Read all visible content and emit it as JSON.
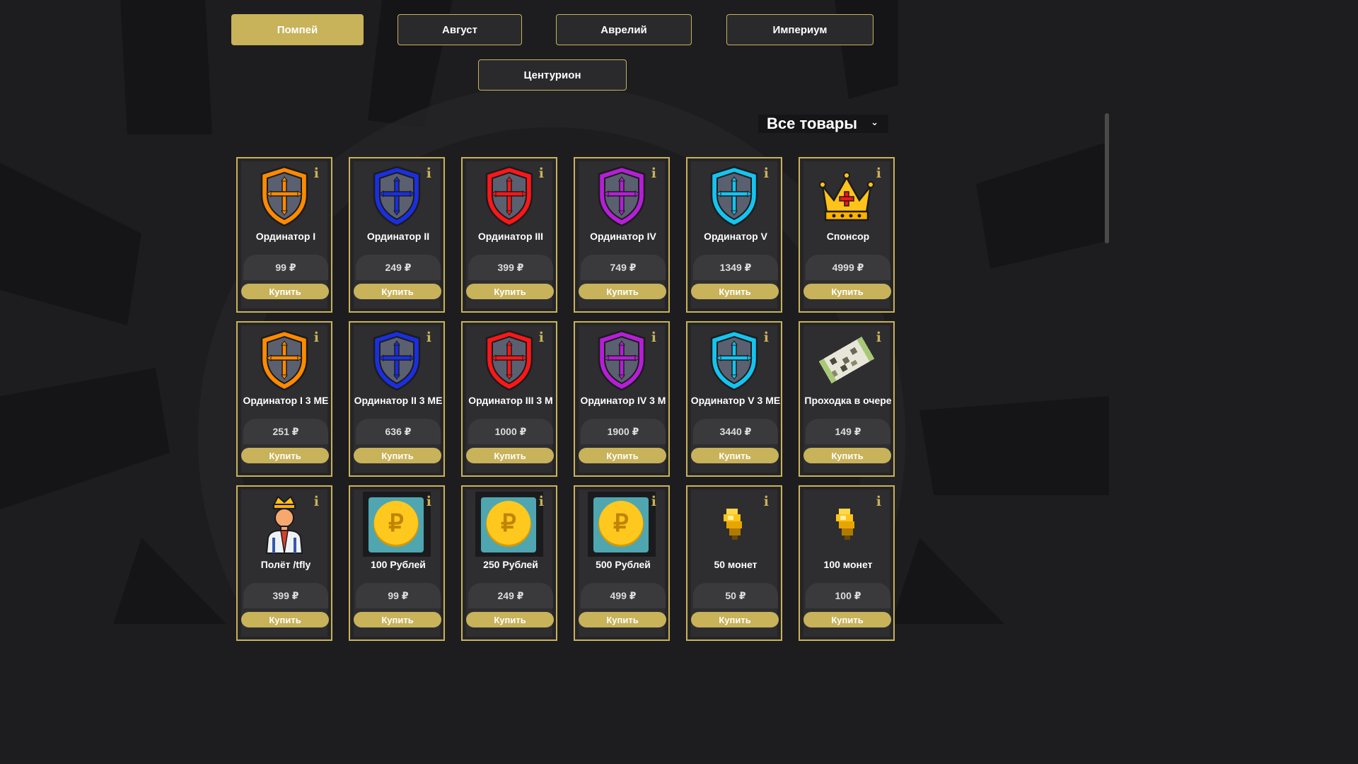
{
  "servers": {
    "pompey": "Помпей",
    "august": "Август",
    "aurelius": "Аврелий",
    "imperium": "Империум",
    "centurion": "Центурион"
  },
  "filter": {
    "label": "Все товары"
  },
  "buy_label": "Купить",
  "info_glyph": "i",
  "colors": {
    "gold": "#c8b25a",
    "orange": "#ff8a00",
    "blue": "#1a2fe0",
    "red": "#ff1616",
    "purple": "#b61ed8",
    "cyan": "#14c4f0"
  },
  "products": [
    {
      "name": "Ординатор I",
      "price": "99 ₽",
      "icon": "shield-orange-icon"
    },
    {
      "name": "Ординатор II",
      "price": "249 ₽",
      "icon": "shield-blue-icon"
    },
    {
      "name": "Ординатор III",
      "price": "399 ₽",
      "icon": "shield-red-icon"
    },
    {
      "name": "Ординатор IV",
      "price": "749 ₽",
      "icon": "shield-purple-icon"
    },
    {
      "name": "Ординатор V",
      "price": "1349 ₽",
      "icon": "shield-cyan-icon"
    },
    {
      "name": "Спонсор",
      "price": "4999 ₽",
      "icon": "crown-icon"
    },
    {
      "name": "Ординатор I 3 МЕ",
      "price": "251 ₽",
      "icon": "shield-orange-icon"
    },
    {
      "name": "Ординатор II 3 МЕ",
      "price": "636 ₽",
      "icon": "shield-blue-icon"
    },
    {
      "name": "Ординатор III 3 М",
      "price": "1000 ₽",
      "icon": "shield-red-icon"
    },
    {
      "name": "Ординатор IV 3 М",
      "price": "1900 ₽",
      "icon": "shield-purple-icon"
    },
    {
      "name": "Ординатор V 3 МЕ",
      "price": "3440 ₽",
      "icon": "shield-cyan-icon"
    },
    {
      "name": "Проходка в очере",
      "price": "149 ₽",
      "icon": "paper-ticket-icon"
    },
    {
      "name": "Полёт /tfly",
      "price": "399 ₽",
      "icon": "king-person-icon"
    },
    {
      "name": "100 Рублей",
      "price": "99 ₽",
      "icon": "ruble-coin-icon"
    },
    {
      "name": "250 Рублей",
      "price": "249 ₽",
      "icon": "ruble-coin-icon"
    },
    {
      "name": "500 Рублей",
      "price": "499 ₽",
      "icon": "ruble-coin-icon"
    },
    {
      "name": "50 монет",
      "price": "50 ₽",
      "icon": "gold-nugget-icon"
    },
    {
      "name": "100 монет",
      "price": "100 ₽",
      "icon": "gold-nugget-icon"
    }
  ]
}
